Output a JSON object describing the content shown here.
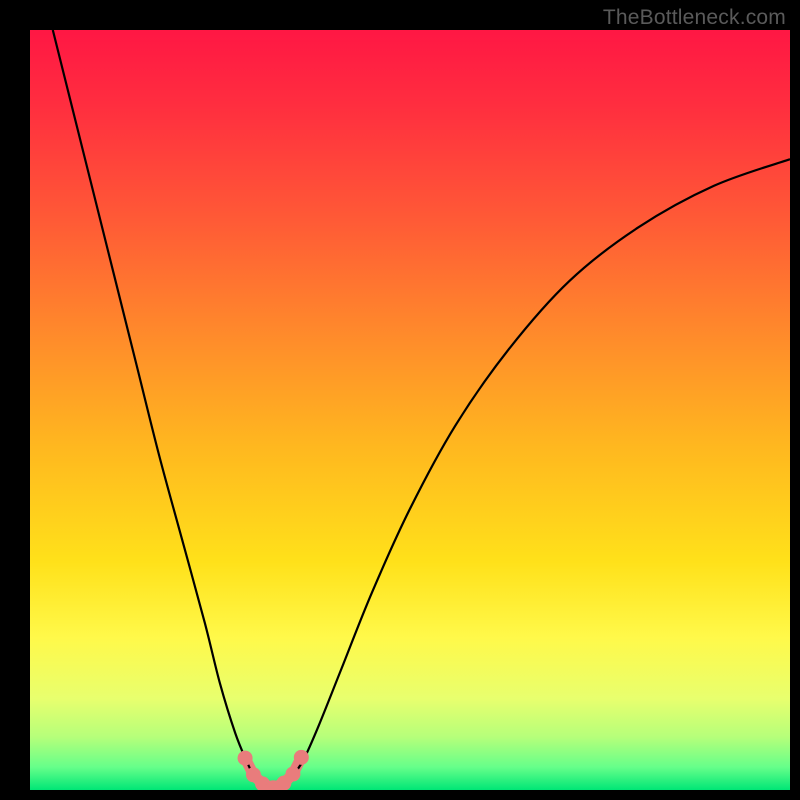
{
  "watermark": "TheBottleneck.com",
  "colors": {
    "gradient_stops": [
      {
        "offset": 0.0,
        "color": "#ff1744"
      },
      {
        "offset": 0.1,
        "color": "#ff2e3f"
      },
      {
        "offset": 0.25,
        "color": "#ff5a36"
      },
      {
        "offset": 0.4,
        "color": "#ff8a2b"
      },
      {
        "offset": 0.55,
        "color": "#ffb81f"
      },
      {
        "offset": 0.7,
        "color": "#ffe11a"
      },
      {
        "offset": 0.8,
        "color": "#fff94a"
      },
      {
        "offset": 0.88,
        "color": "#e8ff6e"
      },
      {
        "offset": 0.93,
        "color": "#b6ff7a"
      },
      {
        "offset": 0.97,
        "color": "#66ff8a"
      },
      {
        "offset": 1.0,
        "color": "#00e676"
      }
    ],
    "curve": "#000000",
    "marker": "#e97c7c",
    "background": "#000000"
  },
  "chart_data": {
    "type": "line",
    "title": "",
    "xlabel": "",
    "ylabel": "",
    "xlim": [
      0,
      100
    ],
    "ylim": [
      0,
      100
    ],
    "curve_points": [
      {
        "x": 3.0,
        "y": 100.0
      },
      {
        "x": 5.0,
        "y": 92.0
      },
      {
        "x": 8.0,
        "y": 80.0
      },
      {
        "x": 11.0,
        "y": 68.0
      },
      {
        "x": 14.0,
        "y": 56.0
      },
      {
        "x": 17.0,
        "y": 44.0
      },
      {
        "x": 20.0,
        "y": 33.0
      },
      {
        "x": 23.0,
        "y": 22.0
      },
      {
        "x": 25.0,
        "y": 14.0
      },
      {
        "x": 27.0,
        "y": 7.5
      },
      {
        "x": 28.5,
        "y": 3.8
      },
      {
        "x": 29.5,
        "y": 1.8
      },
      {
        "x": 30.5,
        "y": 0.8
      },
      {
        "x": 31.5,
        "y": 0.3
      },
      {
        "x": 32.5,
        "y": 0.3
      },
      {
        "x": 33.5,
        "y": 0.8
      },
      {
        "x": 34.5,
        "y": 1.8
      },
      {
        "x": 36.0,
        "y": 4.0
      },
      {
        "x": 38.0,
        "y": 8.5
      },
      {
        "x": 41.0,
        "y": 16.0
      },
      {
        "x": 45.0,
        "y": 26.0
      },
      {
        "x": 50.0,
        "y": 37.0
      },
      {
        "x": 56.0,
        "y": 48.0
      },
      {
        "x": 63.0,
        "y": 58.0
      },
      {
        "x": 71.0,
        "y": 67.0
      },
      {
        "x": 80.0,
        "y": 74.0
      },
      {
        "x": 90.0,
        "y": 79.5
      },
      {
        "x": 100.0,
        "y": 83.0
      }
    ],
    "marker_points": [
      {
        "x": 28.3,
        "y": 4.2
      },
      {
        "x": 29.4,
        "y": 2.0
      },
      {
        "x": 30.6,
        "y": 0.8
      },
      {
        "x": 32.0,
        "y": 0.3
      },
      {
        "x": 33.4,
        "y": 0.9
      },
      {
        "x": 34.6,
        "y": 2.1
      },
      {
        "x": 35.7,
        "y": 4.3
      }
    ],
    "notes": "x and y are in percent of the plot area (0–100). y=0 is bottom (green), y=100 is top (red). Curve is a V-shaped bottleneck profile with minimum ~x≈32. Salmon markers trace the bottom of the V."
  }
}
